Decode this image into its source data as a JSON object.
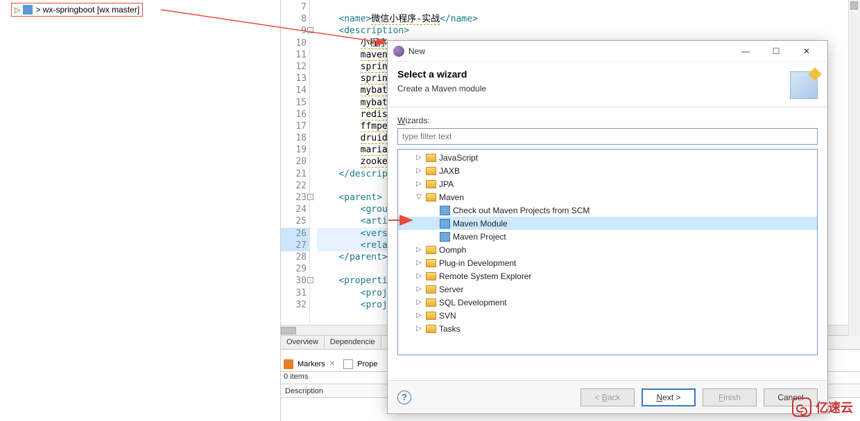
{
  "project": {
    "arrow": "▷",
    "name": "> wx-springboot  [wx master]"
  },
  "editor": {
    "lines": [
      {
        "num": 7,
        "html": ""
      },
      {
        "num": 8,
        "html": "    <span class='tag'>&lt;name&gt;</span><span class='wavy'>微信小程序-实战</span><span class='tag'>&lt;/name&gt;</span>"
      },
      {
        "num": 9,
        "fold": "-",
        "html": "    <span class='tag'>&lt;description&gt;</span>"
      },
      {
        "num": 10,
        "html": "        <span class='wavy'>小程序</span>"
      },
      {
        "num": 11,
        "html": "        <span class='wavy'>maven</span>"
      },
      {
        "num": 12,
        "html": "        <span class='wavy'>sprin</span>"
      },
      {
        "num": 13,
        "html": "        <span class='wavy'>sprin</span>"
      },
      {
        "num": 14,
        "html": "        <span class='wavy'>mybat</span>"
      },
      {
        "num": 15,
        "html": "        <span class='wavy'>mybat</span>"
      },
      {
        "num": 16,
        "html": "        <span class='wavy'>redis</span>"
      },
      {
        "num": 17,
        "html": "        <span class='wavy'>ffmpe</span>"
      },
      {
        "num": 18,
        "html": "        <span class='wavy'>druid</span>"
      },
      {
        "num": 19,
        "html": "        <span class='wavy'>maria</span>"
      },
      {
        "num": 20,
        "html": "        <span class='wavy'>zooke</span>"
      },
      {
        "num": 21,
        "html": "    <span class='tag'>&lt;/descrip</span>"
      },
      {
        "num": 22,
        "html": ""
      },
      {
        "num": 23,
        "fold": "-",
        "html": "    <span class='tag'>&lt;parent&gt;</span>"
      },
      {
        "num": 24,
        "html": "        <span class='tag'>&lt;grou</span>"
      },
      {
        "num": 25,
        "html": "        <span class='tag'>&lt;arti</span>"
      },
      {
        "num": 26,
        "hl": true,
        "html": "        <span class='tag'>&lt;vers</span>"
      },
      {
        "num": 27,
        "hl": true,
        "html": "        <span class='tag'>&lt;rela</span>"
      },
      {
        "num": 28,
        "html": "    <span class='tag'>&lt;/parent&gt;</span>"
      },
      {
        "num": 29,
        "html": ""
      },
      {
        "num": 30,
        "fold": "-",
        "html": "    <span class='tag'>&lt;properti</span>"
      },
      {
        "num": 31,
        "html": "        <span class='tag'>&lt;proj</span>"
      },
      {
        "num": 32,
        "html": "        <span class='tag'>&lt;proj</span>"
      }
    ],
    "tabs": [
      "Overview",
      "Dependencie"
    ]
  },
  "markers": {
    "header_label": "Markers",
    "header_x": "✕",
    "prop_label": "Prope",
    "items": "0 items",
    "col": "Description"
  },
  "dialog": {
    "title": "New",
    "heading": "Select a wizard",
    "subheading": "Create a Maven module",
    "wizards_label": "Wizards:",
    "filter_placeholder": "type filter text",
    "tree": [
      {
        "lvl": 1,
        "caret": "▷",
        "icon": "folder",
        "label": "JavaScript"
      },
      {
        "lvl": 1,
        "caret": "▷",
        "icon": "folder",
        "label": "JAXB"
      },
      {
        "lvl": 1,
        "caret": "▷",
        "icon": "folder",
        "label": "JPA"
      },
      {
        "lvl": 1,
        "caret": "▽",
        "icon": "folder",
        "label": "Maven"
      },
      {
        "lvl": 2,
        "caret": "",
        "icon": "witem",
        "label": "Check out Maven Projects from SCM"
      },
      {
        "lvl": 2,
        "caret": "",
        "icon": "witem",
        "label": "Maven Module",
        "sel": true
      },
      {
        "lvl": 2,
        "caret": "",
        "icon": "witem",
        "label": "Maven Project"
      },
      {
        "lvl": 1,
        "caret": "▷",
        "icon": "folder",
        "label": "Oomph"
      },
      {
        "lvl": 1,
        "caret": "▷",
        "icon": "folder",
        "label": "Plug-in Development"
      },
      {
        "lvl": 1,
        "caret": "▷",
        "icon": "folder",
        "label": "Remote System Explorer"
      },
      {
        "lvl": 1,
        "caret": "▷",
        "icon": "folder",
        "label": "Server"
      },
      {
        "lvl": 1,
        "caret": "▷",
        "icon": "folder",
        "label": "SQL Development"
      },
      {
        "lvl": 1,
        "caret": "▷",
        "icon": "folder",
        "label": "SVN"
      },
      {
        "lvl": 1,
        "caret": "▷",
        "icon": "folder",
        "label": "Tasks"
      }
    ],
    "buttons": {
      "back": "< Back",
      "next": "Next >",
      "finish": "Finish",
      "cancel": "Cancel"
    },
    "help": "?"
  },
  "win": {
    "min": "—",
    "max": "☐",
    "close": "✕"
  },
  "watermark": "亿速云"
}
